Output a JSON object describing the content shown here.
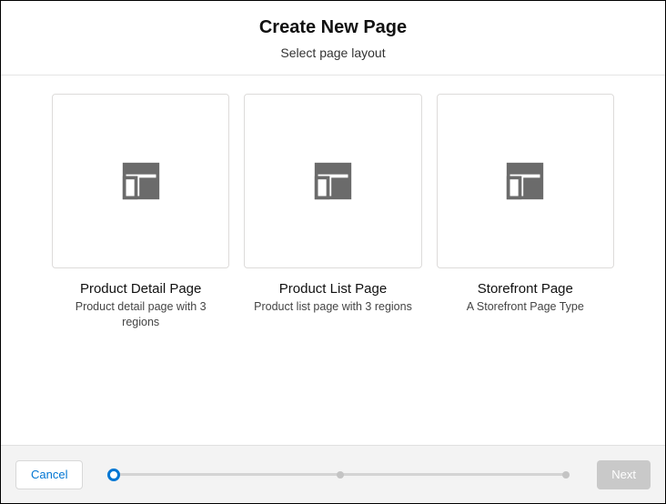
{
  "header": {
    "title": "Create New Page",
    "subtitle": "Select page layout"
  },
  "layouts": [
    {
      "label": "Product Detail Page",
      "description": "Product detail page with 3 regions"
    },
    {
      "label": "Product List Page",
      "description": "Product list page with 3 regions"
    },
    {
      "label": "Storefront Page",
      "description": "A Storefront Page Type"
    }
  ],
  "footer": {
    "cancel": "Cancel",
    "next": "Next"
  },
  "progress": {
    "steps": 3,
    "current": 0
  }
}
